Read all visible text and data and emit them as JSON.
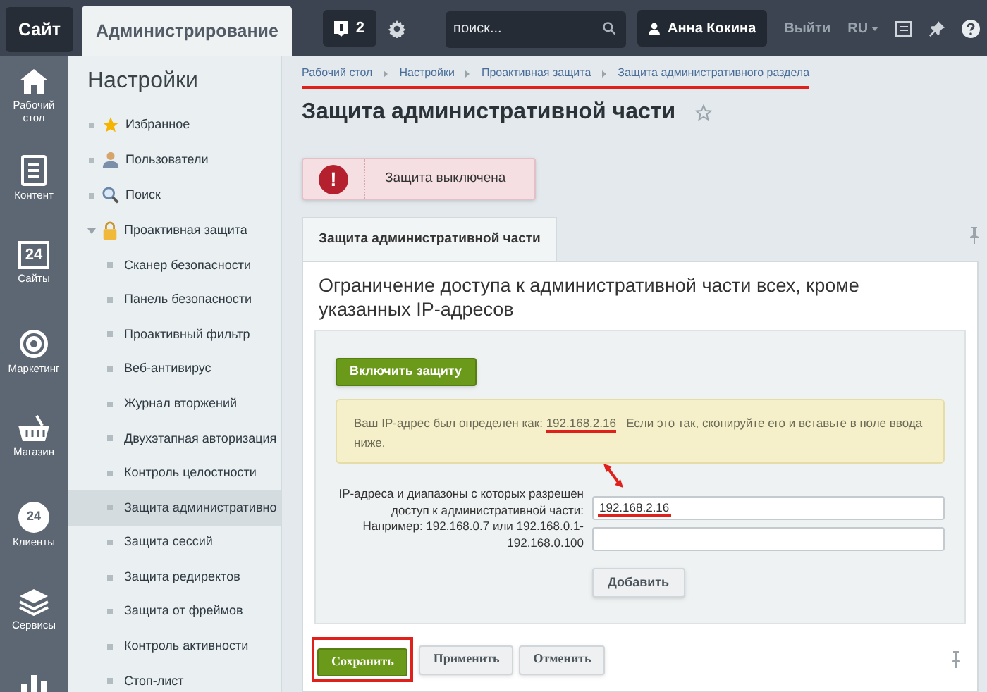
{
  "topbar": {
    "tabs": [
      {
        "label": "Сайт",
        "selected": false
      },
      {
        "label": "Администрирование",
        "selected": true
      }
    ],
    "notifications": {
      "count": "2"
    },
    "search": {
      "placeholder": "поиск..."
    },
    "user": "Анна Кокина",
    "logout": "Выйти",
    "language": "RU"
  },
  "rail": [
    {
      "label": "Рабочий стол",
      "kind": "home"
    },
    {
      "label": "Контент",
      "kind": "doc"
    },
    {
      "label": "Сайты",
      "kind": "calendar",
      "badge": "24"
    },
    {
      "label": "Маркетинг",
      "kind": "target"
    },
    {
      "label": "Магазин",
      "kind": "basket"
    },
    {
      "label": "Клиенты",
      "kind": "crm",
      "badge": "24"
    },
    {
      "label": "Сервисы",
      "kind": "layers"
    },
    {
      "kind": "chart"
    }
  ],
  "menu": {
    "title": "Настройки",
    "items": [
      {
        "label": "Избранное",
        "kind": "star",
        "expanded": false,
        "selected": false
      },
      {
        "label": "Пользователи",
        "kind": "user",
        "expanded": false,
        "selected": false
      },
      {
        "label": "Поиск",
        "kind": "search",
        "expanded": false,
        "selected": false
      },
      {
        "label": "Проактивная защита",
        "kind": "lock",
        "expanded": true,
        "selected": false,
        "children": [
          {
            "label": "Сканер безопасности",
            "selected": false
          },
          {
            "label": "Панель безопасности",
            "selected": false
          },
          {
            "label": "Проактивный фильтр",
            "selected": false
          },
          {
            "label": "Веб-антивирус",
            "selected": false
          },
          {
            "label": "Журнал вторжений",
            "selected": false
          },
          {
            "label": "Двухэтапная авторизация",
            "selected": false
          },
          {
            "label": "Контроль целостности",
            "selected": false
          },
          {
            "label": "Защита административно",
            "selected": true
          },
          {
            "label": "Защита сессий",
            "selected": false
          },
          {
            "label": "Защита редиректов",
            "selected": false
          },
          {
            "label": "Защита от фреймов",
            "selected": false
          },
          {
            "label": "Контроль активности",
            "selected": false
          },
          {
            "label": "Стоп-лист",
            "selected": false
          }
        ]
      }
    ]
  },
  "breadcrumbs": [
    "Рабочий стол",
    "Настройки",
    "Проактивная защита",
    "Защита административного раздела"
  ],
  "page_title": "Защита административной части",
  "favorite": false,
  "alert": {
    "icon": "!",
    "text": "Защита выключена"
  },
  "tabs": [
    {
      "label": "Защита административной части",
      "selected": true
    }
  ],
  "section_title": "Ограничение доступа к административной части всех, кроме указанных IP-адресов",
  "enable_button": "Включить защиту",
  "note": {
    "before": "Ваш IP-адрес был определен как:",
    "ip": "192.168.2.16",
    "after": "Если это так, скопируйте его и вставьте в поле ввода ниже."
  },
  "form": {
    "label": "IP-адреса и диапазоны с которых разрешен доступ к административной части:",
    "example": "Например: 192.168.0.7 или 192.168.0.1-192.168.0.100",
    "values": [
      "192.168.2.16"
    ],
    "add_button": "Добавить"
  },
  "actions": [
    {
      "label": "Сохранить",
      "kind": "primary"
    },
    {
      "label": "Применить",
      "kind": "secondary"
    },
    {
      "label": "Отменить",
      "kind": "secondary"
    }
  ]
}
